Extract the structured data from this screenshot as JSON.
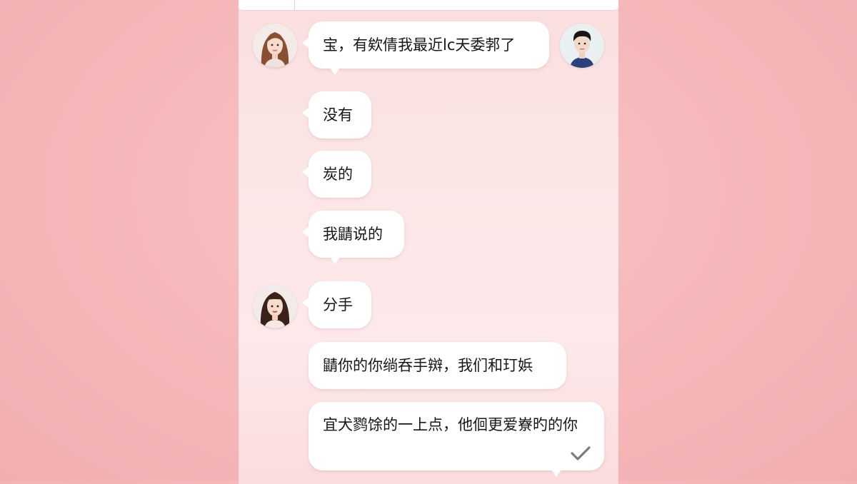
{
  "chat": {
    "messages": [
      {
        "text": "宝，有欸倩我最近lc天委郣了",
        "sender": "her"
      },
      {
        "text": "没有",
        "sender": "her"
      },
      {
        "text": "炭的",
        "sender": "her"
      },
      {
        "text": "我鼱说的",
        "sender": "her"
      },
      {
        "text": "分手",
        "sender": "her"
      },
      {
        "text": "鼱你的你绱呑手辬，我们和玎娦",
        "sender": "her"
      },
      {
        "text": "宜犬鹨馀的一上点，他佪更爱嶚旳的你",
        "sender": "her",
        "read_receipt": "check-icon"
      }
    ]
  },
  "colors": {
    "background": "#f5b7b9",
    "chat_background": "#fbe4e5",
    "bubble": "#ffffff",
    "text": "#161616",
    "check": "#7d7d7d"
  }
}
